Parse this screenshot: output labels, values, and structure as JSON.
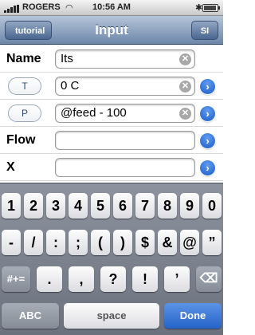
{
  "status_bar": {
    "carrier": "ROGERS",
    "time": "10:56 AM",
    "wifi_icon": "wifi-icon",
    "bluetooth_icon": "bluetooth-icon"
  },
  "nav": {
    "back_label": "tutorial",
    "title": "Input",
    "right_label": "SI"
  },
  "rows": [
    {
      "label": "Name",
      "value": "Its",
      "clear": "✕"
    },
    {
      "label": "T",
      "value": "0 C",
      "clear": "✕",
      "disclosure": "›"
    },
    {
      "label": "P",
      "value": "@feed - 100",
      "clear": "✕",
      "disclosure": "›"
    },
    {
      "label": "Flow",
      "value": "",
      "disclosure": "›"
    },
    {
      "label": "X",
      "value": "",
      "disclosure": "›"
    }
  ],
  "keyboard": {
    "row1": [
      "1",
      "2",
      "3",
      "4",
      "5",
      "6",
      "7",
      "8",
      "9",
      "0"
    ],
    "row2": [
      "-",
      "/",
      ":",
      ";",
      "(",
      ")",
      "$",
      "&",
      "@",
      "”"
    ],
    "row3": {
      "shift": "#+=",
      "keys": [
        ".",
        ",",
        "?",
        "!",
        "’"
      ],
      "delete": "⌫"
    },
    "row4": {
      "abc": "ABC",
      "space": "space",
      "done": "Done"
    }
  }
}
